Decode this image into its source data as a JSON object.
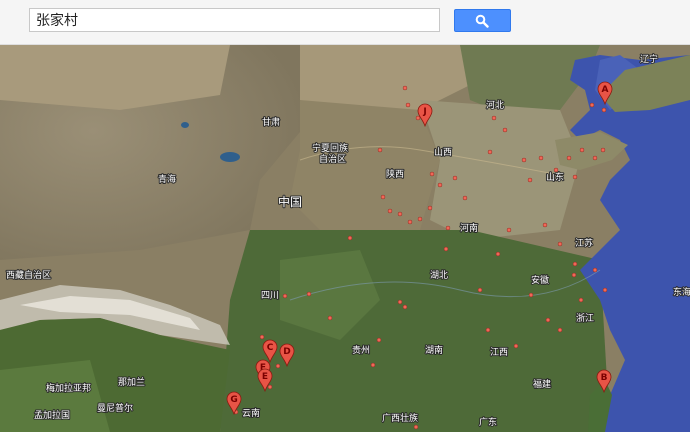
{
  "search": {
    "query": "张家村"
  },
  "colors": {
    "water": "#3d54ad",
    "pin": "#e85446",
    "dot": "#f06858",
    "button": "#4d90fe"
  },
  "labels": {
    "liaoning": "辽宁",
    "hebei": "河北",
    "gansu": "甘肃",
    "ningxia_1": "宁夏回族",
    "ningxia_2": "自治区",
    "shanxi": "山西",
    "qinghai": "青海",
    "shaanxi": "陕西",
    "shandong": "山东",
    "china": "中国",
    "henan": "河南",
    "jiangsu": "江苏",
    "tibet": "西藏自治区",
    "hubei": "湖北",
    "anhui": "安徽",
    "sichuan": "四川",
    "zhejiang": "浙江",
    "dongha": "东海",
    "guizhou": "贵州",
    "hunan": "湖南",
    "jiangxi": "江西",
    "fujian": "福建",
    "meghalaya": "梅加拉亚邦",
    "bengal": "那加兰",
    "bangladesh": "孟加拉国",
    "manipur": "曼尼普尔",
    "yunnan": "云南",
    "guangxi": "广西壮族",
    "guangdong": "广东"
  },
  "markers": [
    {
      "letter": "A"
    },
    {
      "letter": "B"
    },
    {
      "letter": "C"
    },
    {
      "letter": "D"
    },
    {
      "letter": "E"
    },
    {
      "letter": "F"
    },
    {
      "letter": "G"
    },
    {
      "letter": "J"
    }
  ]
}
